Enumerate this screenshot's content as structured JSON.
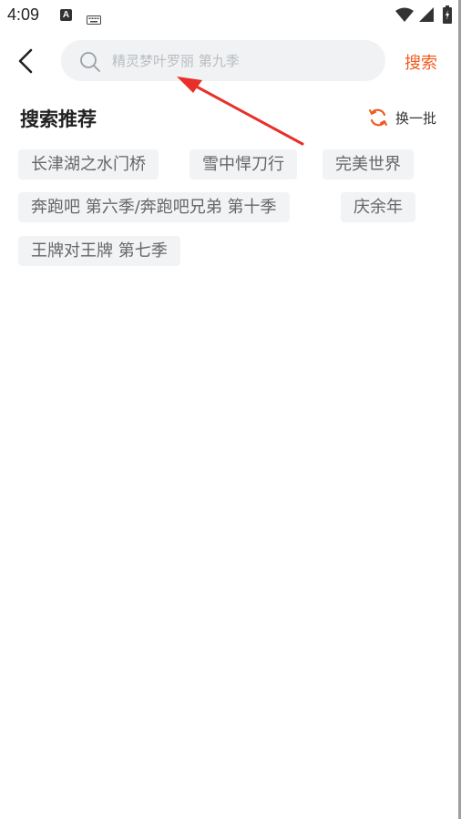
{
  "status_bar": {
    "time": "4:09",
    "a_icon_letter": "A",
    "icons": [
      "a-icon",
      "keyboard-icon",
      "wifi-icon",
      "signal-icon",
      "battery-icon"
    ]
  },
  "header": {
    "back_icon": "chevron-left-icon",
    "search_placeholder": "精灵梦叶罗丽 第九季",
    "search_value": "",
    "search_icon": "search-icon",
    "search_button_label": "搜索"
  },
  "recommend": {
    "title": "搜索推荐",
    "refresh_label": "换一批",
    "refresh_icon": "refresh-icon",
    "tags": [
      "长津湖之水门桥",
      "雪中悍刀行",
      "完美世界",
      "奔跑吧 第六季/奔跑吧兄弟 第十季",
      "庆余年",
      "王牌对王牌 第七季"
    ]
  },
  "colors": {
    "accent": "#f05a1e",
    "tag_bg": "#f2f3f5",
    "tag_text": "#666666",
    "search_bg": "#f0f2f3",
    "placeholder": "#b9bdc1",
    "annotation": "#e8302a"
  }
}
